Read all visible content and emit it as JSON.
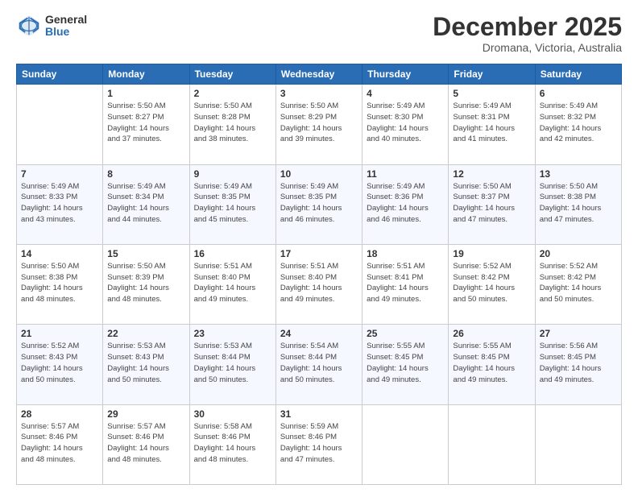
{
  "logo": {
    "general": "General",
    "blue": "Blue"
  },
  "header": {
    "month": "December 2025",
    "location": "Dromana, Victoria, Australia"
  },
  "days_of_week": [
    "Sunday",
    "Monday",
    "Tuesday",
    "Wednesday",
    "Thursday",
    "Friday",
    "Saturday"
  ],
  "weeks": [
    [
      {
        "day": "",
        "info": ""
      },
      {
        "day": "1",
        "info": "Sunrise: 5:50 AM\nSunset: 8:27 PM\nDaylight: 14 hours\nand 37 minutes."
      },
      {
        "day": "2",
        "info": "Sunrise: 5:50 AM\nSunset: 8:28 PM\nDaylight: 14 hours\nand 38 minutes."
      },
      {
        "day": "3",
        "info": "Sunrise: 5:50 AM\nSunset: 8:29 PM\nDaylight: 14 hours\nand 39 minutes."
      },
      {
        "day": "4",
        "info": "Sunrise: 5:49 AM\nSunset: 8:30 PM\nDaylight: 14 hours\nand 40 minutes."
      },
      {
        "day": "5",
        "info": "Sunrise: 5:49 AM\nSunset: 8:31 PM\nDaylight: 14 hours\nand 41 minutes."
      },
      {
        "day": "6",
        "info": "Sunrise: 5:49 AM\nSunset: 8:32 PM\nDaylight: 14 hours\nand 42 minutes."
      }
    ],
    [
      {
        "day": "7",
        "info": "Sunrise: 5:49 AM\nSunset: 8:33 PM\nDaylight: 14 hours\nand 43 minutes."
      },
      {
        "day": "8",
        "info": "Sunrise: 5:49 AM\nSunset: 8:34 PM\nDaylight: 14 hours\nand 44 minutes."
      },
      {
        "day": "9",
        "info": "Sunrise: 5:49 AM\nSunset: 8:35 PM\nDaylight: 14 hours\nand 45 minutes."
      },
      {
        "day": "10",
        "info": "Sunrise: 5:49 AM\nSunset: 8:35 PM\nDaylight: 14 hours\nand 46 minutes."
      },
      {
        "day": "11",
        "info": "Sunrise: 5:49 AM\nSunset: 8:36 PM\nDaylight: 14 hours\nand 46 minutes."
      },
      {
        "day": "12",
        "info": "Sunrise: 5:50 AM\nSunset: 8:37 PM\nDaylight: 14 hours\nand 47 minutes."
      },
      {
        "day": "13",
        "info": "Sunrise: 5:50 AM\nSunset: 8:38 PM\nDaylight: 14 hours\nand 47 minutes."
      }
    ],
    [
      {
        "day": "14",
        "info": "Sunrise: 5:50 AM\nSunset: 8:38 PM\nDaylight: 14 hours\nand 48 minutes."
      },
      {
        "day": "15",
        "info": "Sunrise: 5:50 AM\nSunset: 8:39 PM\nDaylight: 14 hours\nand 48 minutes."
      },
      {
        "day": "16",
        "info": "Sunrise: 5:51 AM\nSunset: 8:40 PM\nDaylight: 14 hours\nand 49 minutes."
      },
      {
        "day": "17",
        "info": "Sunrise: 5:51 AM\nSunset: 8:40 PM\nDaylight: 14 hours\nand 49 minutes."
      },
      {
        "day": "18",
        "info": "Sunrise: 5:51 AM\nSunset: 8:41 PM\nDaylight: 14 hours\nand 49 minutes."
      },
      {
        "day": "19",
        "info": "Sunrise: 5:52 AM\nSunset: 8:42 PM\nDaylight: 14 hours\nand 50 minutes."
      },
      {
        "day": "20",
        "info": "Sunrise: 5:52 AM\nSunset: 8:42 PM\nDaylight: 14 hours\nand 50 minutes."
      }
    ],
    [
      {
        "day": "21",
        "info": "Sunrise: 5:52 AM\nSunset: 8:43 PM\nDaylight: 14 hours\nand 50 minutes."
      },
      {
        "day": "22",
        "info": "Sunrise: 5:53 AM\nSunset: 8:43 PM\nDaylight: 14 hours\nand 50 minutes."
      },
      {
        "day": "23",
        "info": "Sunrise: 5:53 AM\nSunset: 8:44 PM\nDaylight: 14 hours\nand 50 minutes."
      },
      {
        "day": "24",
        "info": "Sunrise: 5:54 AM\nSunset: 8:44 PM\nDaylight: 14 hours\nand 50 minutes."
      },
      {
        "day": "25",
        "info": "Sunrise: 5:55 AM\nSunset: 8:45 PM\nDaylight: 14 hours\nand 49 minutes."
      },
      {
        "day": "26",
        "info": "Sunrise: 5:55 AM\nSunset: 8:45 PM\nDaylight: 14 hours\nand 49 minutes."
      },
      {
        "day": "27",
        "info": "Sunrise: 5:56 AM\nSunset: 8:45 PM\nDaylight: 14 hours\nand 49 minutes."
      }
    ],
    [
      {
        "day": "28",
        "info": "Sunrise: 5:57 AM\nSunset: 8:46 PM\nDaylight: 14 hours\nand 48 minutes."
      },
      {
        "day": "29",
        "info": "Sunrise: 5:57 AM\nSunset: 8:46 PM\nDaylight: 14 hours\nand 48 minutes."
      },
      {
        "day": "30",
        "info": "Sunrise: 5:58 AM\nSunset: 8:46 PM\nDaylight: 14 hours\nand 48 minutes."
      },
      {
        "day": "31",
        "info": "Sunrise: 5:59 AM\nSunset: 8:46 PM\nDaylight: 14 hours\nand 47 minutes."
      },
      {
        "day": "",
        "info": ""
      },
      {
        "day": "",
        "info": ""
      },
      {
        "day": "",
        "info": ""
      }
    ]
  ]
}
